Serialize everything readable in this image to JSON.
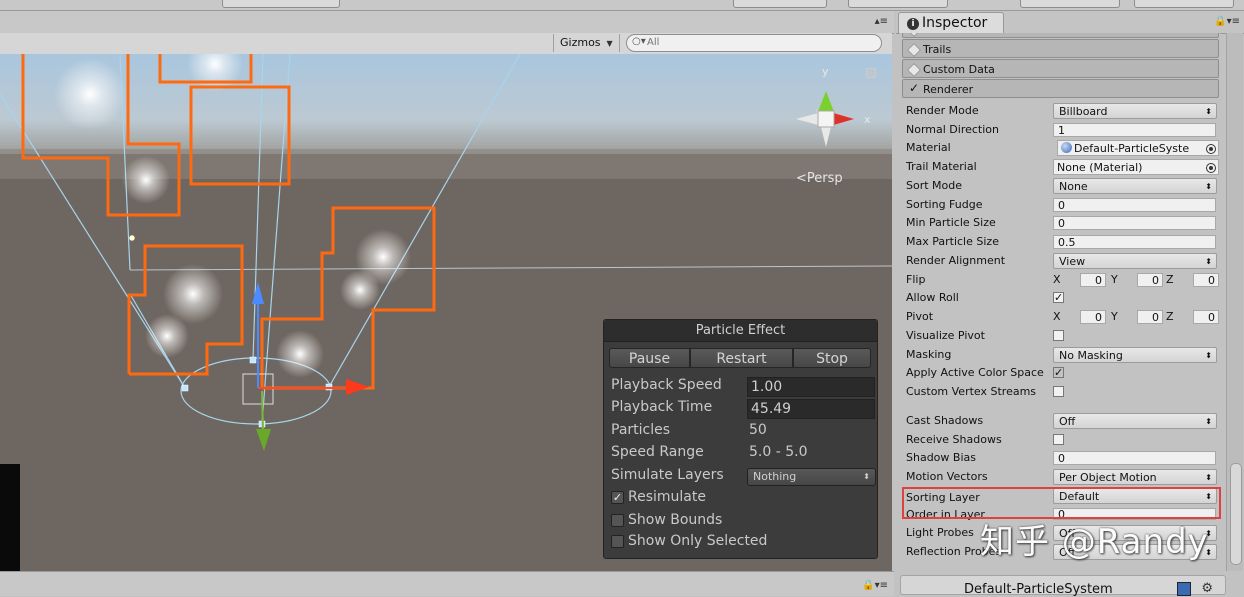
{
  "scene": {
    "gizmos_label": "Gizmos",
    "search_placeholder": "All",
    "camera_label": "Persp"
  },
  "particle_effect": {
    "title": "Particle Effect",
    "buttons": {
      "pause": "Pause",
      "restart": "Restart",
      "stop": "Stop"
    },
    "rows": [
      {
        "label": "Playback Speed",
        "value": "1.00"
      },
      {
        "label": "Playback Time",
        "value": "45.49"
      },
      {
        "label": "Particles",
        "value": "50"
      },
      {
        "label": "Speed Range",
        "value": "5.0 - 5.0"
      }
    ],
    "simulate_layers": {
      "label": "Simulate Layers",
      "value": "Nothing"
    },
    "checks": [
      {
        "label": "Resimulate",
        "checked": true
      },
      {
        "label": "Show Bounds",
        "checked": false
      },
      {
        "label": "Show Only Selected",
        "checked": false
      }
    ]
  },
  "inspector": {
    "tab_title": "Inspector",
    "modules": {
      "trails": "Trails",
      "custom_data": "Custom Data",
      "renderer": "Renderer"
    },
    "props": {
      "render_mode": {
        "label": "Render Mode",
        "value": "Billboard"
      },
      "normal_direction": {
        "label": "Normal Direction",
        "value": "1"
      },
      "material": {
        "label": "Material",
        "value": "Default-ParticleSyste"
      },
      "trail_material": {
        "label": "Trail Material",
        "value": "None (Material)"
      },
      "sort_mode": {
        "label": "Sort Mode",
        "value": "None"
      },
      "sorting_fudge": {
        "label": "Sorting Fudge",
        "value": "0"
      },
      "min_particle_size": {
        "label": "Min Particle Size",
        "value": "0"
      },
      "max_particle_size": {
        "label": "Max Particle Size",
        "value": "0.5"
      },
      "render_alignment": {
        "label": "Render Alignment",
        "value": "View"
      },
      "flip": {
        "label": "Flip",
        "x": "0",
        "y": "0",
        "z": "0"
      },
      "allow_roll": {
        "label": "Allow Roll",
        "checked": true
      },
      "pivot": {
        "label": "Pivot",
        "x": "0",
        "y": "0",
        "z": "0"
      },
      "visualize_pivot": {
        "label": "Visualize Pivot",
        "checked": false
      },
      "masking": {
        "label": "Masking",
        "value": "No Masking"
      },
      "apply_active_color_space": {
        "label": "Apply Active Color Space",
        "checked": true
      },
      "custom_vertex_streams": {
        "label": "Custom Vertex Streams",
        "checked": false
      },
      "cast_shadows": {
        "label": "Cast Shadows",
        "value": "Off"
      },
      "receive_shadows": {
        "label": "Receive Shadows",
        "checked": false
      },
      "shadow_bias": {
        "label": "Shadow Bias",
        "value": "0"
      },
      "motion_vectors": {
        "label": "Motion Vectors",
        "value": "Per Object Motion"
      },
      "sorting_layer": {
        "label": "Sorting Layer",
        "value": "Default"
      },
      "order_in_layer": {
        "label": "Order in Layer",
        "value": "0"
      },
      "light_probes": {
        "label": "Light Probes",
        "value": "Off"
      },
      "reflection_probes": {
        "label": "Reflection Probes",
        "value": "Off"
      }
    },
    "axis_labels": {
      "x": "X",
      "y": "Y",
      "z": "Z"
    },
    "preview_title": "Default-ParticleSystem"
  },
  "watermark": "知乎 @Randy",
  "colors": {
    "highlight": "#e04040",
    "selection_outline": "#ff6a10"
  }
}
